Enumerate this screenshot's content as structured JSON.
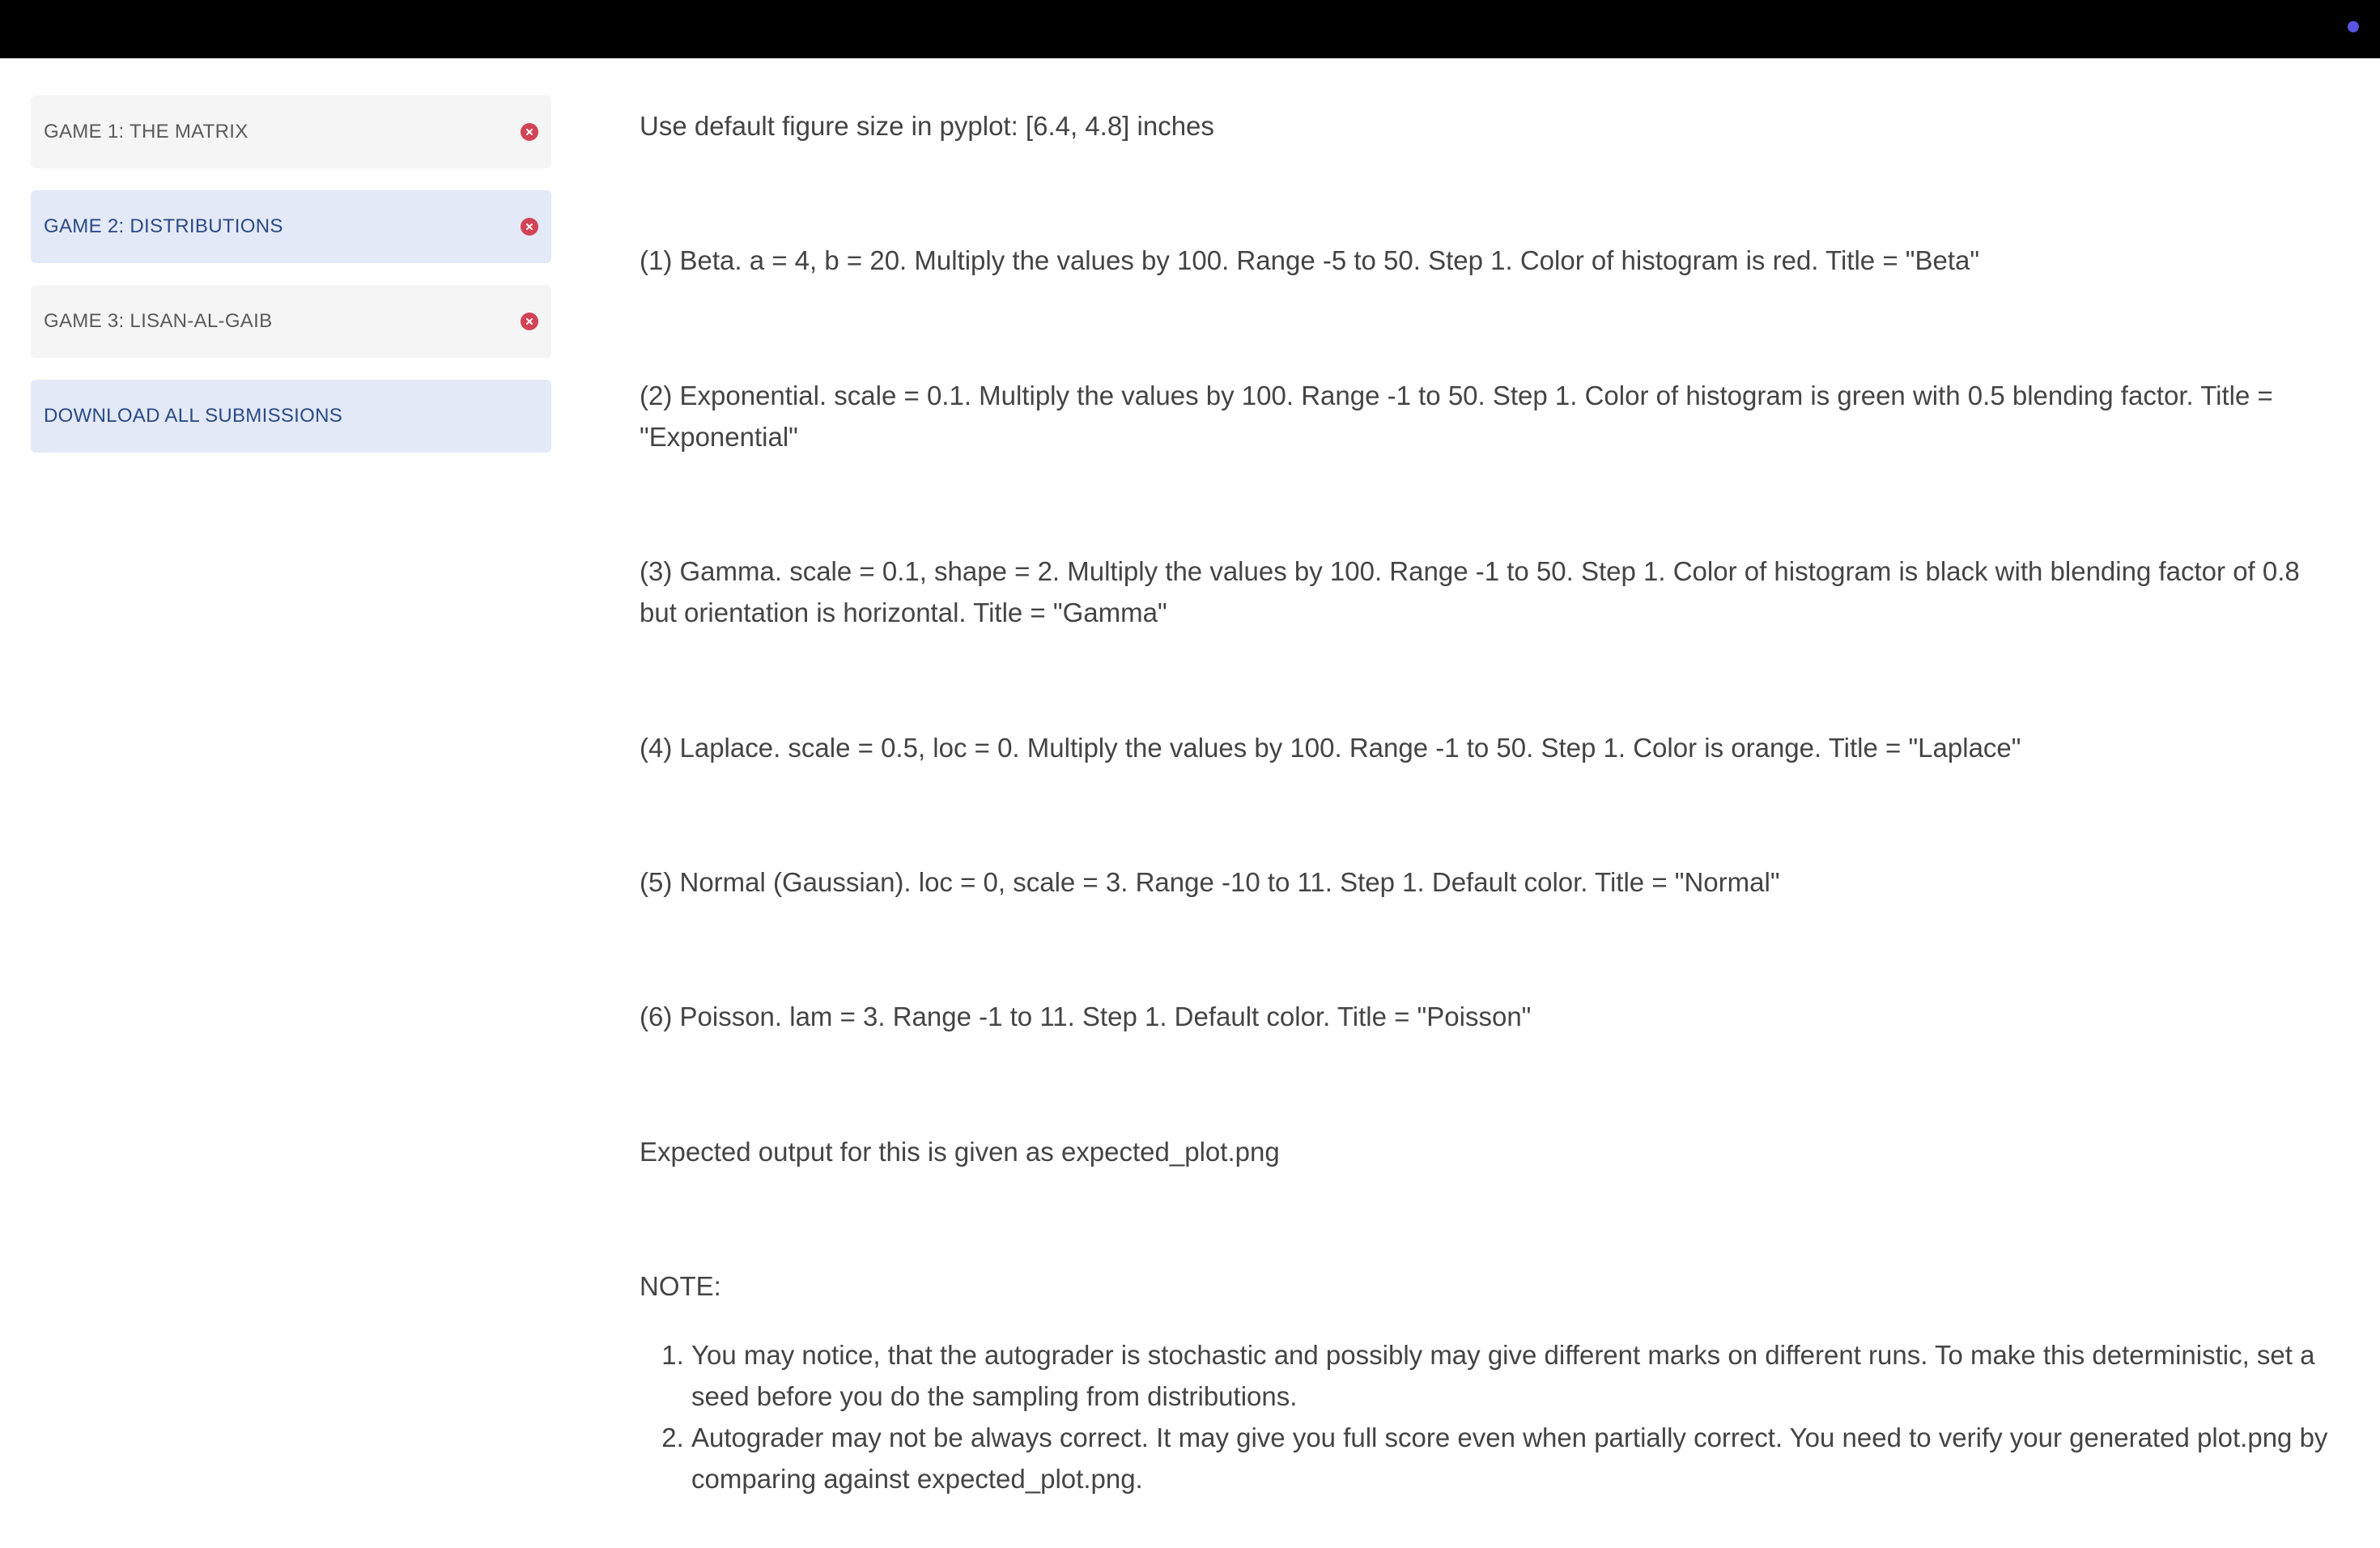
{
  "sidebar": {
    "games": [
      {
        "label": "GAME 1: THE MATRIX",
        "active": false
      },
      {
        "label": "GAME 2: DISTRIBUTIONS",
        "active": true
      },
      {
        "label": "GAME 3: LISAN-AL-GAIB",
        "active": false
      }
    ],
    "download_label": "DOWNLOAD ALL SUBMISSIONS"
  },
  "content": {
    "intro": "Use default figure size in pyplot: [6.4, 4.8] inches",
    "items": [
      "(1) Beta. a = 4, b = 20. Multiply the values by 100. Range -5 to 50. Step 1. Color of histogram is red. Title = \"Beta\"",
      "(2) Exponential. scale = 0.1. Multiply the values by 100. Range -1 to 50. Step 1. Color of histogram is green with 0.5 blending factor. Title = \"Exponential\"",
      "(3) Gamma. scale = 0.1, shape = 2. Multiply the values by 100. Range -1 to 50. Step 1. Color of histogram is black with blending factor of 0.8 but orientation is horizontal. Title = \"Gamma\"",
      "(4) Laplace. scale = 0.5, loc = 0. Multiply the values by 100. Range -1 to 50. Step 1. Color is orange. Title = \"Laplace\"",
      "(5) Normal (Gaussian). loc = 0, scale = 3. Range -10 to 11. Step 1. Default color. Title = \"Normal\"",
      "(6) Poisson. lam = 3. Range -1 to 11. Step 1. Default color. Title = \"Poisson\""
    ],
    "expected": "Expected output for this is given as expected_plot.png",
    "note_heading": "NOTE:",
    "notes": [
      "You may notice, that the autograder is stochastic and possibly may give different marks on different runs. To make this deterministic, set a seed before you do the sampling from distributions.",
      "Autograder may not be always correct. It may give you full score even when partially correct. You need to verify your generated plot.png by comparing against expected_plot.png."
    ]
  },
  "colors": {
    "topbar": "#000000",
    "status_dot": "#5b54e0",
    "remove_icon": "#d14355",
    "active_item_bg": "#e3e9f6",
    "inactive_item_bg": "#f5f5f5",
    "active_text": "#2a4a86"
  },
  "icons": {
    "remove": "close-circle-icon",
    "status": "status-dot-icon"
  }
}
